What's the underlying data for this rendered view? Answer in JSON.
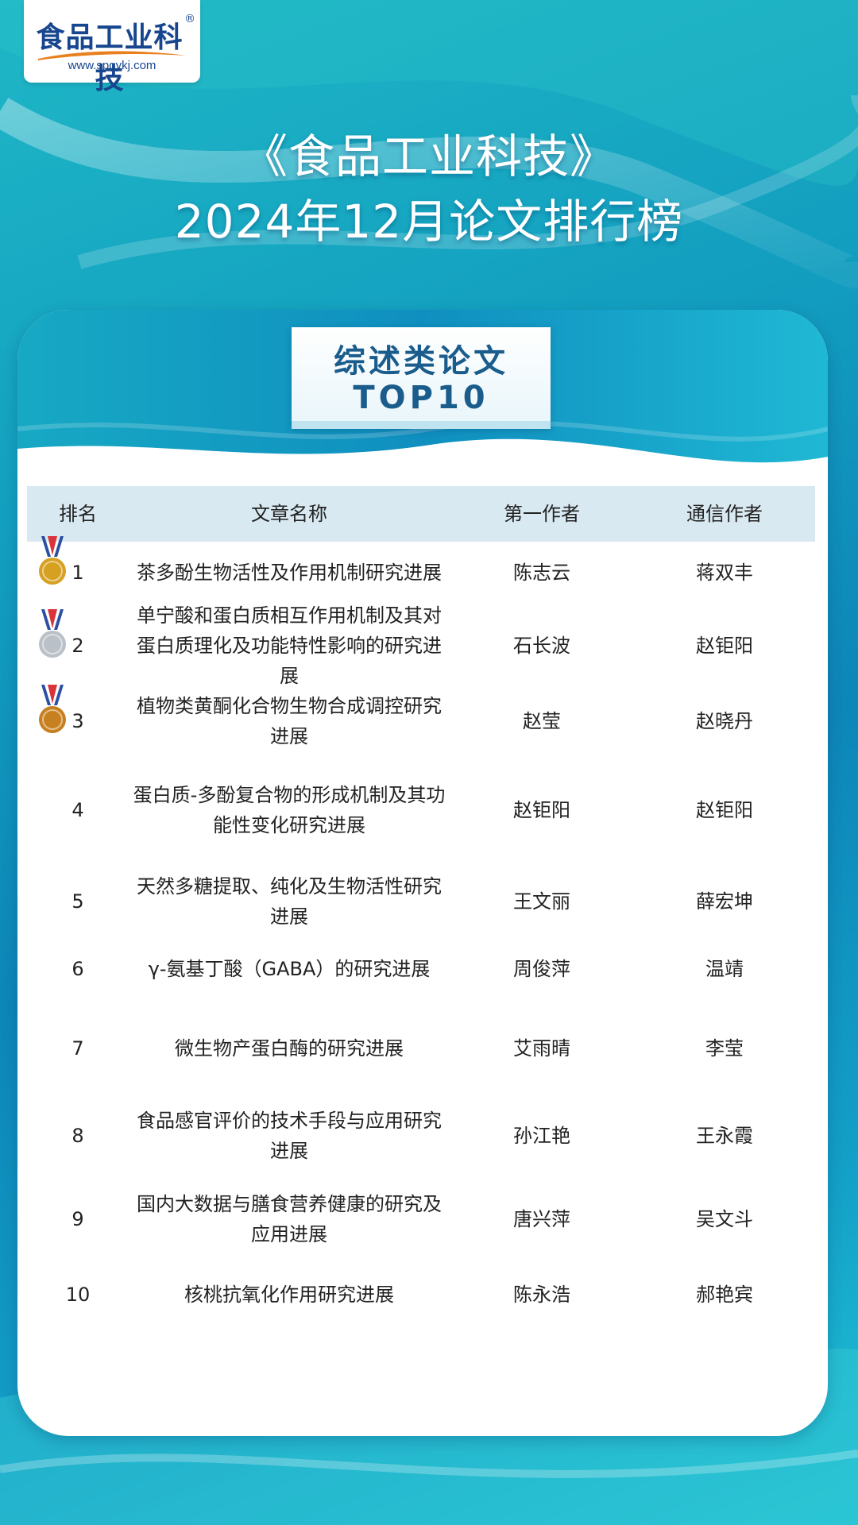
{
  "logo": {
    "name": "食品工业科技",
    "registered": "®",
    "url": "www.spgykj.com"
  },
  "title": {
    "line1": "《食品工业科技》",
    "line2": "2024年12月论文排行榜"
  },
  "badge": {
    "line1": "综述类论文",
    "line2": "TOP10"
  },
  "table": {
    "headers": [
      "排名",
      "文章名称",
      "第一作者",
      "通信作者"
    ],
    "rows": [
      {
        "rank": "1",
        "title": "茶多酚生物活性及作用机制研究进展",
        "first_author": "陈志云",
        "corresponding_author": "蒋双丰",
        "medal": "gold"
      },
      {
        "rank": "2",
        "title": "单宁酸和蛋白质相互作用机制及其对蛋白质理化及功能特性影响的研究进展",
        "first_author": "石长波",
        "corresponding_author": "赵钜阳",
        "medal": "silver"
      },
      {
        "rank": "3",
        "title": "植物类黄酮化合物生物合成调控研究进展",
        "first_author": "赵莹",
        "corresponding_author": "赵晓丹",
        "medal": "bronze"
      },
      {
        "rank": "4",
        "title": "蛋白质-多酚复合物的形成机制及其功能性变化研究进展",
        "first_author": "赵钜阳",
        "corresponding_author": "赵钜阳"
      },
      {
        "rank": "5",
        "title": "天然多糖提取、纯化及生物活性研究进展",
        "first_author": "王文丽",
        "corresponding_author": "薛宏坤"
      },
      {
        "rank": "6",
        "title": "γ-氨基丁酸（GABA）的研究进展",
        "first_author": "周俊萍",
        "corresponding_author": "温靖"
      },
      {
        "rank": "7",
        "title": "微生物产蛋白酶的研究进展",
        "first_author": "艾雨晴",
        "corresponding_author": "李莹"
      },
      {
        "rank": "8",
        "title": "食品感官评价的技术手段与应用研究进展",
        "first_author": "孙江艳",
        "corresponding_author": "王永霞"
      },
      {
        "rank": "9",
        "title": "国内大数据与膳食营养健康的研究及应用进展",
        "first_author": "唐兴萍",
        "corresponding_author": "吴文斗"
      },
      {
        "rank": "10",
        "title": "核桃抗氧化作用研究进展",
        "first_author": "陈永浩",
        "corresponding_author": "郝艳宾"
      }
    ]
  },
  "colors": {
    "gold": "#d6a021",
    "silver": "#b9c0c7",
    "bronze": "#c7801f",
    "ribbon_blue": "#2b4fa3",
    "ribbon_red": "#d8343a",
    "header_bg": "#d9e9f1",
    "badge_text": "#1a5d8c"
  }
}
